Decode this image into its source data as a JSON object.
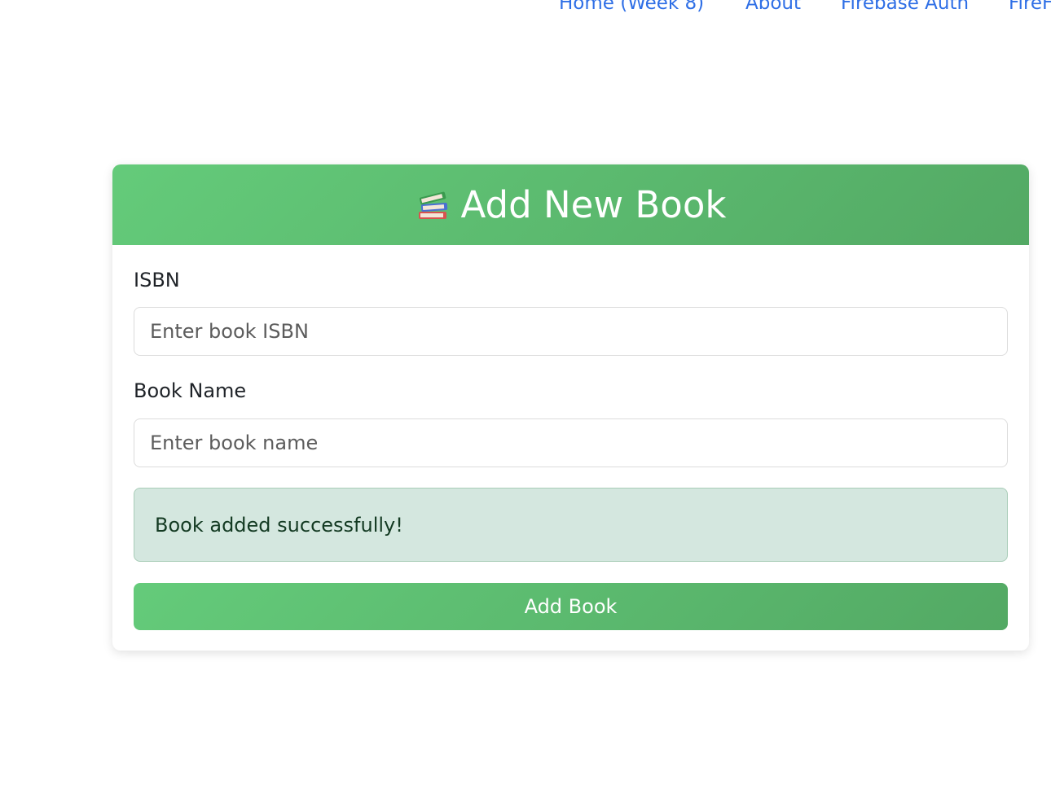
{
  "nav": {
    "links": [
      {
        "label": "Home (Week 8)"
      },
      {
        "label": "About"
      },
      {
        "label": "Firebase Auth"
      },
      {
        "label": "FireF"
      }
    ]
  },
  "form": {
    "header_icon": "books-icon",
    "title": "Add New Book",
    "isbn": {
      "label": "ISBN",
      "value": "",
      "placeholder": "Enter book ISBN"
    },
    "book_name": {
      "label": "Book Name",
      "value": "",
      "placeholder": "Enter book name"
    },
    "alert": "Book added successfully!",
    "submit_label": "Add Book"
  },
  "colors": {
    "accent_start": "#64cb7a",
    "accent_end": "#53a964",
    "link": "#2f6fe6",
    "alert_bg": "#d4e7df",
    "alert_border": "#a9cdb8"
  }
}
